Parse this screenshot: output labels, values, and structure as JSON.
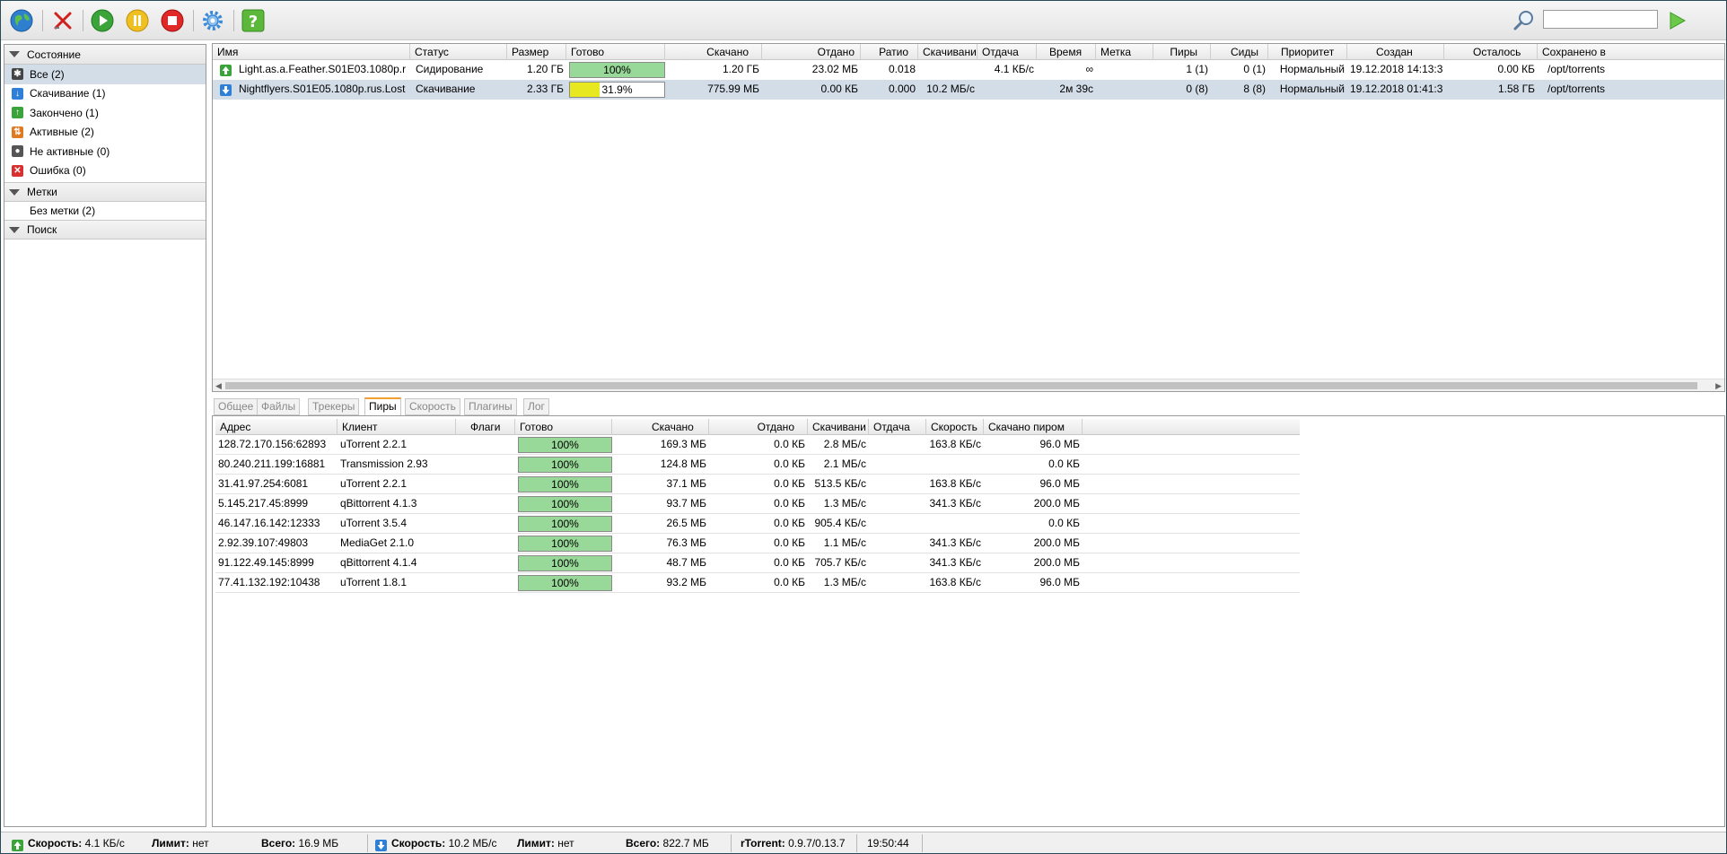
{
  "toolbar": {
    "icons": [
      "globe-icon",
      "delete-icon",
      "start-icon",
      "pause-icon",
      "stop-icon",
      "settings-icon",
      "help-icon",
      "search-icon",
      "go-icon"
    ],
    "search_value": ""
  },
  "sidebar": {
    "state_header": "Состояние",
    "items": [
      {
        "label": "Все (2)",
        "icon": "all-icon",
        "color": "#444444"
      },
      {
        "label": "Скачивание (1)",
        "icon": "download-icon",
        "color": "#2d7fd8"
      },
      {
        "label": "Закончено (1)",
        "icon": "finished-icon",
        "color": "#3aa33a"
      },
      {
        "label": "Активные (2)",
        "icon": "active-icon",
        "color": "#e07a20"
      },
      {
        "label": "Не активные (0)",
        "icon": "inactive-icon",
        "color": "#555555"
      },
      {
        "label": "Ошибка (0)",
        "icon": "error-icon",
        "color": "#d83030"
      }
    ],
    "labels_header": "Метки",
    "labels_items": [
      "Без метки (2)"
    ],
    "search_header": "Поиск"
  },
  "torrents": {
    "columns": [
      "Имя",
      "Статус",
      "Размер",
      "Готово",
      "Скачано",
      "Отдано",
      "Ратио",
      "Скачивани",
      "Отдача",
      "Время",
      "Метка",
      "Пиры",
      "Сиды",
      "Приоритет",
      "Создан",
      "Осталось",
      "Сохранено в"
    ],
    "rows": [
      {
        "name": "Light.as.a.Feather.S01E03.1080p.r",
        "status": "Сидирование",
        "size": "1.20 ГБ",
        "done": "100%",
        "done_fraction": 1.0,
        "done_color": "#98d898",
        "downloaded": "1.20 ГБ",
        "uploaded": "23.02 МБ",
        "ratio": "0.018",
        "dl_speed": "",
        "ul_speed": "4.1 КБ/с",
        "eta": "∞",
        "label": "",
        "peers": "1 (1)",
        "seeds": "0 (1)",
        "priority": "Нормальный",
        "created": "19.12.2018 14:13:3",
        "remaining": "0.00 КБ",
        "saved_to": "/opt/torrents",
        "state_icon": "seeding-icon"
      },
      {
        "name": "Nightflyers.S01E05.1080p.rus.Lost",
        "status": "Скачивание",
        "size": "2.33 ГБ",
        "done": "31.9%",
        "done_fraction": 0.319,
        "done_color": "#e8e820",
        "downloaded": "775.99 МБ",
        "uploaded": "0.00 КБ",
        "ratio": "0.000",
        "dl_speed": "10.2 МБ/с",
        "ul_speed": "",
        "eta": "2м 39с",
        "label": "",
        "peers": "0 (8)",
        "seeds": "8 (8)",
        "priority": "Нормальный",
        "created": "19.12.2018 01:41:3",
        "remaining": "1.58 ГБ",
        "saved_to": "/opt/torrents",
        "state_icon": "downloading-icon"
      }
    ]
  },
  "tabs": [
    "Общее",
    "Файлы",
    "Трекеры",
    "Пиры",
    "Скорость",
    "Плагины",
    "Лог"
  ],
  "active_tab": "Пиры",
  "peers": {
    "columns": [
      "Адрес",
      "Клиент",
      "Флаги",
      "Готово",
      "Скачано",
      "Отдано",
      "Скачивани",
      "Отдача",
      "Скорость",
      "Скачано пиром"
    ],
    "rows": [
      {
        "address": "128.72.170.156:62893",
        "client": "uTorrent 2.2.1",
        "flags": "",
        "done": "100%",
        "downloaded": "169.3 МБ",
        "uploaded": "0.0 КБ",
        "dl": "2.8 МБ/с",
        "ul": "",
        "speed": "163.8 КБ/с",
        "peer_dl": "96.0 МБ"
      },
      {
        "address": "80.240.211.199:16881",
        "client": "Transmission 2.93",
        "flags": "",
        "done": "100%",
        "downloaded": "124.8 МБ",
        "uploaded": "0.0 КБ",
        "dl": "2.1 МБ/с",
        "ul": "",
        "speed": "",
        "peer_dl": "0.0 КБ"
      },
      {
        "address": "31.41.97.254:6081",
        "client": "uTorrent 2.2.1",
        "flags": "",
        "done": "100%",
        "downloaded": "37.1 МБ",
        "uploaded": "0.0 КБ",
        "dl": "513.5 КБ/с",
        "ul": "",
        "speed": "163.8 КБ/с",
        "peer_dl": "96.0 МБ"
      },
      {
        "address": "5.145.217.45:8999",
        "client": "qBittorrent 4.1.3",
        "flags": "",
        "done": "100%",
        "downloaded": "93.7 МБ",
        "uploaded": "0.0 КБ",
        "dl": "1.3 МБ/с",
        "ul": "",
        "speed": "341.3 КБ/с",
        "peer_dl": "200.0 МБ"
      },
      {
        "address": "46.147.16.142:12333",
        "client": "uTorrent 3.5.4",
        "flags": "",
        "done": "100%",
        "downloaded": "26.5 МБ",
        "uploaded": "0.0 КБ",
        "dl": "905.4 КБ/с",
        "ul": "",
        "speed": "",
        "peer_dl": "0.0 КБ"
      },
      {
        "address": "2.92.39.107:49803",
        "client": "MediaGet 2.1.0",
        "flags": "",
        "done": "100%",
        "downloaded": "76.3 МБ",
        "uploaded": "0.0 КБ",
        "dl": "1.1 МБ/с",
        "ul": "",
        "speed": "341.3 КБ/с",
        "peer_dl": "200.0 МБ"
      },
      {
        "address": "91.122.49.145:8999",
        "client": "qBittorrent 4.1.4",
        "flags": "",
        "done": "100%",
        "downloaded": "48.7 МБ",
        "uploaded": "0.0 КБ",
        "dl": "705.7 КБ/с",
        "ul": "",
        "speed": "341.3 КБ/с",
        "peer_dl": "200.0 МБ"
      },
      {
        "address": "77.41.132.192:10438",
        "client": "uTorrent 1.8.1",
        "flags": "",
        "done": "100%",
        "downloaded": "93.2 МБ",
        "uploaded": "0.0 КБ",
        "dl": "1.3 МБ/с",
        "ul": "",
        "speed": "163.8 КБ/с",
        "peer_dl": "96.0 МБ"
      }
    ]
  },
  "statusbar": {
    "ul_speed_label": "Скорость:",
    "ul_speed": "4.1 КБ/с",
    "ul_limit_label": "Лимит:",
    "ul_limit": "нет",
    "ul_total_label": "Всего:",
    "ul_total": "16.9 МБ",
    "dl_speed_label": "Скорость:",
    "dl_speed": "10.2 МБ/с",
    "dl_limit_label": "Лимит:",
    "dl_limit": "нет",
    "dl_total_label": "Всего:",
    "dl_total": "822.7 МБ",
    "version_label": "rTorrent:",
    "version": "0.9.7/0.13.7",
    "time": "19:50:44"
  },
  "colors": {
    "selection": "#d3dde8",
    "progress_full": "#98d898",
    "progress_partial": "#e8e820",
    "active_tab_accent": "#f0a030"
  }
}
